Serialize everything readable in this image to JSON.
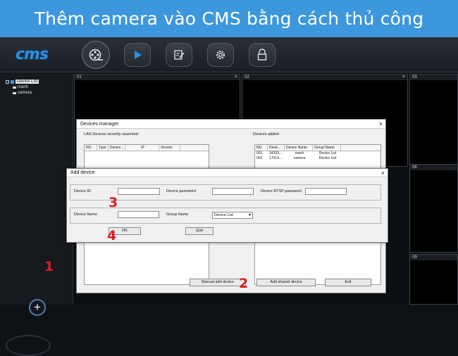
{
  "banner": {
    "title": "Thêm camera vào CMS bằng cách thủ công"
  },
  "app": {
    "logo": "cms",
    "nav": [
      "camera-reel-icon",
      "play-icon",
      "edit-icon",
      "gear-icon",
      "lock-icon"
    ],
    "accent": "#3d97dc"
  },
  "tree": {
    "root": "Device List",
    "children": [
      "manh",
      "camera"
    ]
  },
  "grid": {
    "cells": [
      {
        "id": "01",
        "close": "×"
      },
      {
        "id": "02",
        "close": "×"
      },
      {
        "id": "03",
        "close": ""
      },
      {
        "id": "06",
        "close": ""
      },
      {
        "id": "09",
        "close": ""
      }
    ]
  },
  "devices_manager": {
    "title": "Devices manager",
    "close": "×",
    "lan_label": "LAN Devices recently searched:",
    "lan_columns": [
      "NO.",
      "Type",
      "Device...",
      "IP",
      "Version"
    ],
    "added_label": "Devices added:",
    "added_columns": [
      "NO.",
      "Devic...",
      "Device Name",
      "Group Name"
    ],
    "added_rows": [
      [
        "001",
        "24333...",
        "manh",
        "Device List"
      ],
      [
        "002",
        "17014...",
        "camera",
        "Device List"
      ]
    ],
    "buttons": {
      "manual": "Manual add device",
      "shared": "Add shared device",
      "exit": "Exit"
    }
  },
  "add_device": {
    "title": "Add device",
    "close": "×",
    "device_id_label": "Device ID",
    "device_id_value": "",
    "password_label": "Device password",
    "password_value": "",
    "rtsp_label": "Device RTSP password",
    "rtsp_value": "",
    "name_label": "Device Name",
    "name_value": "",
    "group_label": "Group Name",
    "group_value": "Device List",
    "ok": "OK",
    "quit": "Quit"
  },
  "steps": {
    "s1": "1",
    "s2": "2",
    "s3": "3",
    "s4": "4"
  },
  "add_symbol": "+"
}
